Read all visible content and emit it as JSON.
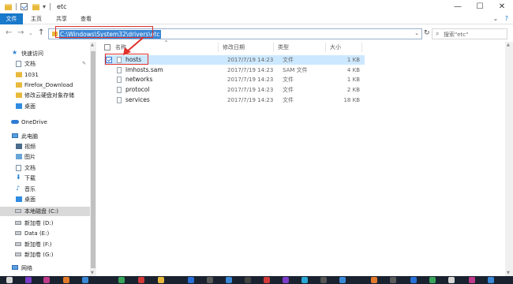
{
  "window": {
    "title": "etc",
    "minimize_glyph": "—",
    "maximize_glyph": "☐",
    "close_glyph": "✕",
    "qat_dropdown_glyph": "▾"
  },
  "ribbon": {
    "tabs": [
      "文件",
      "主页",
      "共享",
      "查看"
    ],
    "expand_glyph": "⌄",
    "help_glyph": "?"
  },
  "nav": {
    "back": "←",
    "forward": "→",
    "recent": "⌄",
    "up": "↑"
  },
  "address": {
    "path": "C:\\Windows\\System32\\drivers\\etc",
    "dropdown": "⌄",
    "refresh": "↻"
  },
  "search": {
    "placeholder": "搜索\"etc\"",
    "icon": "search-icon"
  },
  "sidebar": {
    "items": [
      {
        "label": "快速访问",
        "icon": "star-icon",
        "pinned": false
      },
      {
        "label": "文档",
        "icon": "documents-icon",
        "pinned": true
      },
      {
        "label": "1031",
        "icon": "folder-icon",
        "pinned": false
      },
      {
        "label": "Firefox_Download",
        "icon": "folder-icon",
        "pinned": false
      },
      {
        "label": "修改云硬盘对象存储",
        "icon": "folder-icon",
        "pinned": false
      },
      {
        "label": "桌面",
        "icon": "desktop-icon",
        "pinned": false
      },
      {
        "label": "OneDrive",
        "icon": "cloud-icon",
        "pinned": false
      },
      {
        "label": "此电脑",
        "icon": "computer-icon",
        "pinned": false
      },
      {
        "label": "视频",
        "icon": "video-icon",
        "pinned": false
      },
      {
        "label": "图片",
        "icon": "pictures-icon",
        "pinned": false
      },
      {
        "label": "文档",
        "icon": "documents-icon",
        "pinned": false
      },
      {
        "label": "下载",
        "icon": "download-icon",
        "pinned": false
      },
      {
        "label": "音乐",
        "icon": "music-icon",
        "pinned": false
      },
      {
        "label": "桌面",
        "icon": "desktop-icon",
        "pinned": false
      },
      {
        "label": "本地磁盘 (C:)",
        "icon": "drive-icon",
        "pinned": false
      },
      {
        "label": "新加卷 (D:)",
        "icon": "drive-icon",
        "pinned": false
      },
      {
        "label": "Data (E:)",
        "icon": "drive-icon",
        "pinned": false
      },
      {
        "label": "新加卷 (F:)",
        "icon": "drive-icon",
        "pinned": false
      },
      {
        "label": "新加卷 (G:)",
        "icon": "drive-icon",
        "pinned": false
      },
      {
        "label": "网络",
        "icon": "network-icon",
        "pinned": false
      }
    ],
    "selected": "本地磁盘 (C:)",
    "pin_glyph": "📌"
  },
  "table": {
    "columns": [
      "名称",
      "修改日期",
      "类型",
      "大小"
    ],
    "sort_glyph": "^",
    "rows": [
      {
        "name": "hosts",
        "date": "2017/7/19 14:23",
        "type": "文件",
        "size": "1 KB",
        "selected": true
      },
      {
        "name": "lmhosts.sam",
        "date": "2017/7/19 14:23",
        "type": "SAM 文件",
        "size": "4 KB",
        "selected": false
      },
      {
        "name": "networks",
        "date": "2017/7/19 14:23",
        "type": "文件",
        "size": "1 KB",
        "selected": false
      },
      {
        "name": "protocol",
        "date": "2017/7/19 14:23",
        "type": "文件",
        "size": "2 KB",
        "selected": false
      },
      {
        "name": "services",
        "date": "2017/7/19 14:23",
        "type": "文件",
        "size": "18 KB",
        "selected": false
      }
    ]
  },
  "colors": {
    "accent": "#1979ca",
    "selection": "#cce8ff",
    "annotation": "#e0302a",
    "address_highlight": "#3a86d6"
  }
}
